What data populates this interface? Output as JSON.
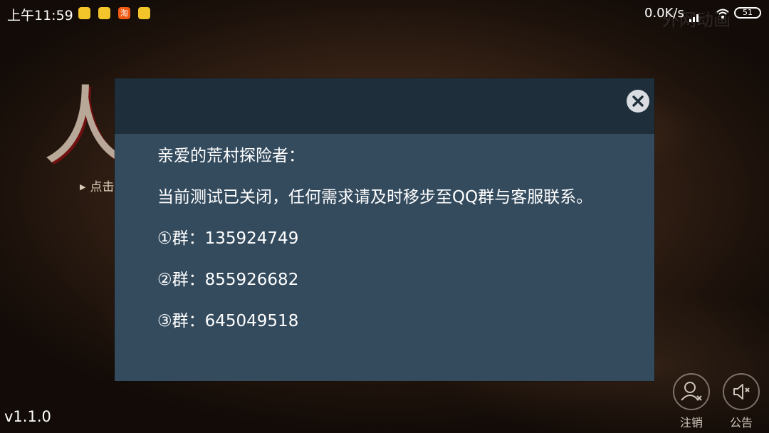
{
  "status_bar": {
    "time": "上午11:59",
    "taobao_icon_text": "淘",
    "network_speed": "0.0K/s",
    "battery": "51",
    "icons": [
      "notification-icon",
      "notification-icon",
      "taobao-icon",
      "notification-icon",
      "signal-icon",
      "wifi-icon",
      "battery-icon"
    ]
  },
  "background": {
    "watermark": "外网动画",
    "title_fragment": "人",
    "tap_hint": "点击"
  },
  "dialog": {
    "greeting": "亲爱的荒村探险者：",
    "message": "当前测试已关闭，任何需求请及时移步至QQ群与客服联系。",
    "groups": [
      {
        "label": "①群：",
        "number": "135924749"
      },
      {
        "label": "②群：",
        "number": "855926682"
      },
      {
        "label": "③群：",
        "number": "645049518"
      }
    ],
    "close_icon": "close-icon"
  },
  "footer": {
    "version": "v1.1.0",
    "logout_label": "注销",
    "notice_label": "公告",
    "logout_icon": "user-logout-icon",
    "notice_icon": "speaker-icon"
  }
}
